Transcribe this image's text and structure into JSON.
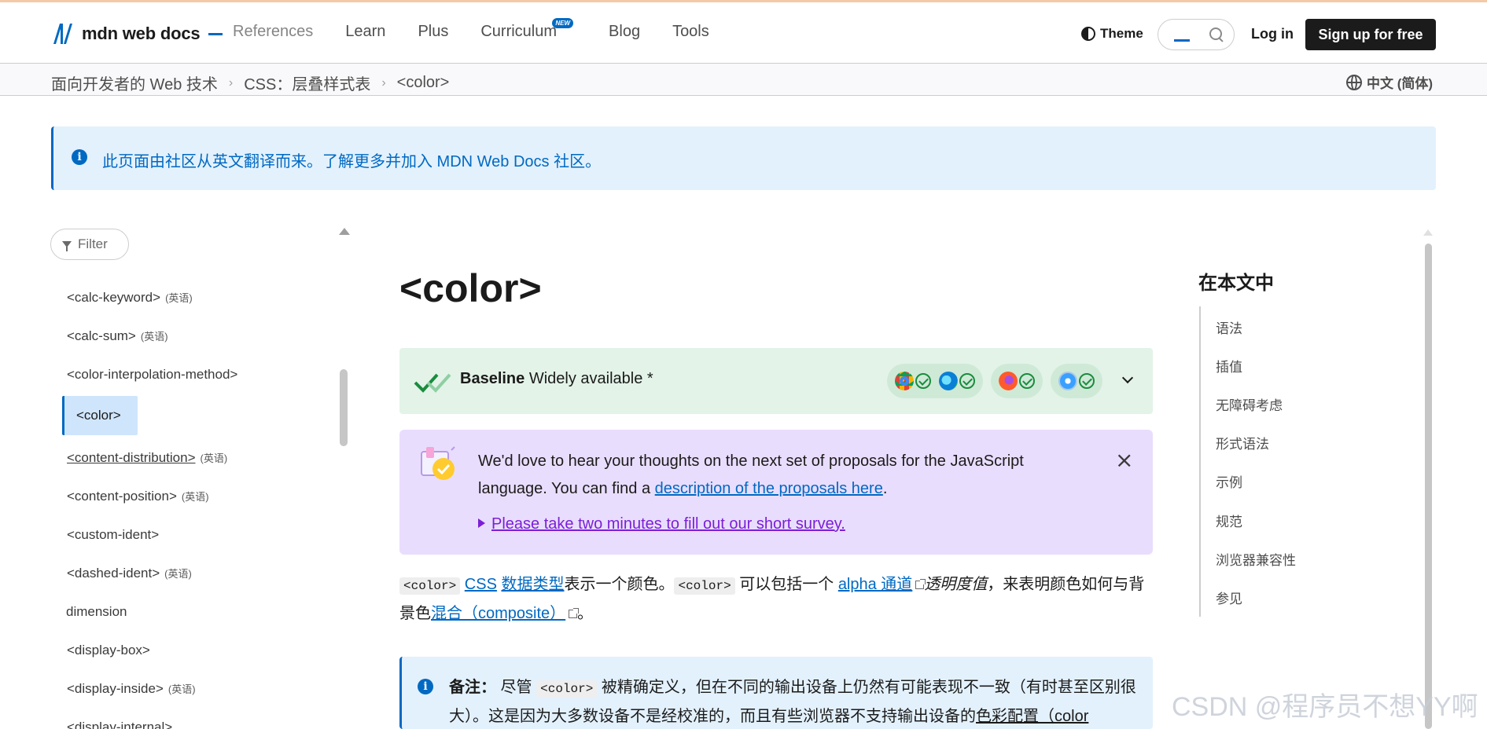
{
  "header": {
    "logo_text": "mdn web docs",
    "nav": [
      "References",
      "Learn",
      "Plus",
      "Curriculum",
      "Blog",
      "Tools"
    ],
    "new_badge": "NEW",
    "theme_label": "Theme",
    "login_label": "Log in",
    "signup_label": "Sign up for free"
  },
  "breadcrumb": {
    "items": [
      "面向开发者的 Web 技术",
      "CSS：层叠样式表",
      "<color>"
    ],
    "language": "中文 (简体)"
  },
  "notice": {
    "text": "此页面由社区从英文翻译而来。了解更多并加入 MDN Web Docs 社区。"
  },
  "sidebar": {
    "filter_label": "Filter",
    "items": [
      {
        "label": "<calc-keyword>",
        "note": "(英语)"
      },
      {
        "label": "<calc-sum>",
        "note": "(英语)"
      },
      {
        "label": "<color-interpolation-method>",
        "note": ""
      },
      {
        "label": "<color>",
        "note": ""
      },
      {
        "label": "<content-distribution>",
        "note": "(英语)"
      },
      {
        "label": "<content-position>",
        "note": "(英语)"
      },
      {
        "label": "<custom-ident>",
        "note": ""
      },
      {
        "label": "<dashed-ident>",
        "note": "(英语)"
      },
      {
        "label": "dimension",
        "note": ""
      },
      {
        "label": "<display-box>",
        "note": ""
      },
      {
        "label": "<display-inside>",
        "note": "(英语)"
      },
      {
        "label": "<display-internal>",
        "note": ""
      }
    ]
  },
  "article": {
    "title": "<color>",
    "baseline": {
      "title_bold": "Baseline",
      "title_rest": " Widely available *"
    },
    "survey": {
      "line1": "We'd love to hear your thoughts on the next set of proposals for the JavaScript language. You can find a ",
      "link": "description of the proposals here",
      "line1_end": ".",
      "details": "Please take two minutes to fill out our short survey.",
      "close": "×"
    },
    "para": {
      "code1": "<color>",
      "css_link": "CSS",
      "type_link": "数据类型",
      "t1": "表示一个颜色。",
      "code2": "<color>",
      "t2": " 可以包括一个 ",
      "alpha_link": "alpha 通道",
      "t3": "透明度值",
      "t4": "，来表明颜色如何与背景色",
      "composite_link": "混合（composite）",
      "t5": "。"
    },
    "note": {
      "label": "备注：",
      "t1": " 尽管 ",
      "code": "<color>",
      "t2": " 被精确定义，但在不同的输出设备上仍然有可能表现不一致（有时甚至区别很大）。这是因为大多数设备不是经校准的，而且有些浏览器不支持输出设备的",
      "link": "色彩配置（color"
    }
  },
  "toc": {
    "title": "在本文中",
    "items": [
      "语法",
      "插值",
      "无障碍考虑",
      "形式语法",
      "示例",
      "规范",
      "浏览器兼容性",
      "参见"
    ]
  },
  "watermark": "CSDN @程序员不想YY啊",
  "colors": {
    "accent": "#0069c2",
    "baseline_bg": "#e3f3e8",
    "survey_bg": "#e9ddfd",
    "notice_bg": "#e3f1fc"
  }
}
